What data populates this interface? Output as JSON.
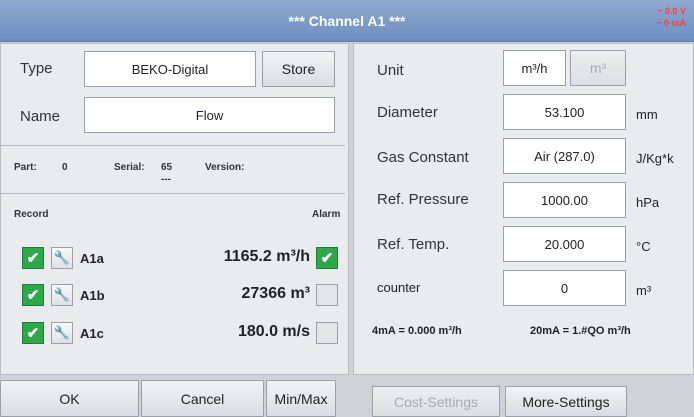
{
  "header": {
    "title": "*** Channel A1 ***",
    "status_voltage": "~ 0.0 V",
    "status_current": "~ 0 mA"
  },
  "left": {
    "type_label": "Type",
    "type_value": "BEKO-Digital",
    "store_label": "Store",
    "name_label": "Name",
    "name_value": "Flow",
    "part_label": "Part:",
    "part_value": "0",
    "serial_label": "Serial:",
    "serial_value": "65",
    "serial_extra": "---",
    "version_label": "Version:",
    "record_label": "Record",
    "alarm_label": "Alarm",
    "channels": [
      {
        "record_checked": true,
        "name": "A1a",
        "value": "1165.2 m³/h",
        "alarm_checked": true
      },
      {
        "record_checked": true,
        "name": "A1b",
        "value": "27366 m³",
        "alarm_checked": false
      },
      {
        "record_checked": true,
        "name": "A1c",
        "value": "180.0 m/s",
        "alarm_checked": false
      }
    ]
  },
  "right": {
    "unit_label": "Unit",
    "unit_option_active": "m³/h",
    "unit_option_inactive": "m³",
    "diameter_label": "Diameter",
    "diameter_value": "53.100",
    "diameter_unit": "mm",
    "gas_label": "Gas Constant",
    "gas_value": "Air (287.0)",
    "gas_unit": "J/Kg*k",
    "refp_label": "Ref. Pressure",
    "refp_value": "1000.00",
    "refp_unit": "hPa",
    "reft_label": "Ref. Temp.",
    "reft_value": "20.000",
    "reft_unit": "°C",
    "counter_label": "counter",
    "counter_value": "0",
    "counter_unit": "m³",
    "ma4": "4mA = 0.000 m³/h",
    "ma20": "20mA = 1.#QO m³/h"
  },
  "buttons": {
    "ok": "OK",
    "cancel": "Cancel",
    "minmax": "Min/Max",
    "cost": "Cost-Settings",
    "more": "More-Settings"
  },
  "icons": {
    "check": "check-icon",
    "wrench": "wrench-icon"
  },
  "colors": {
    "titlebar": "#7b9acb",
    "check_green": "#2ea84a",
    "status_red": "#ff3a3a"
  }
}
